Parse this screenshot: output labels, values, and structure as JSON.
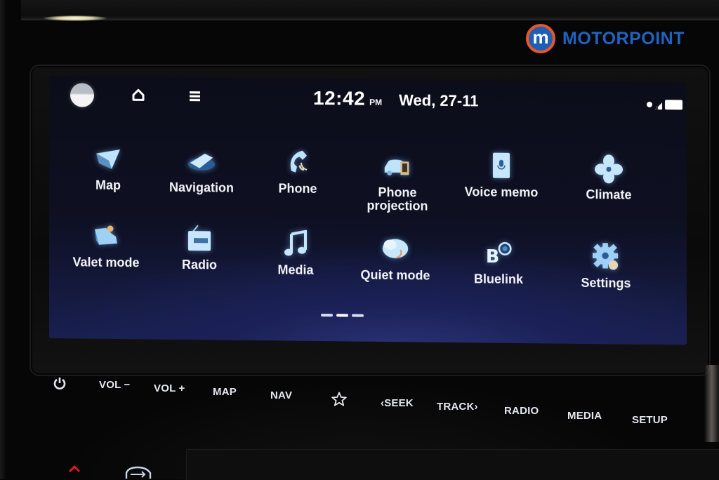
{
  "brand": {
    "logo_letter": "m",
    "name": "MOTORPOINT",
    "colors": {
      "badge": "#1d5fb3",
      "ring": "#e8562a",
      "text": "#1f63c2"
    }
  },
  "status_bar": {
    "time": "12:42",
    "ampm": "PM",
    "date": "Wed, 27-11",
    "icons": [
      "profile-icon",
      "home-icon",
      "menu-icon",
      "signal-icon",
      "battery-icon"
    ]
  },
  "apps": [
    {
      "label": "Map",
      "icon": "map-icon"
    },
    {
      "label": "Navigation",
      "icon": "navigation-icon"
    },
    {
      "label": "Phone",
      "icon": "phone-icon"
    },
    {
      "label": "Phone projection",
      "label_line1": "Phone",
      "label_line2": "projection",
      "icon": "phone-projection-icon"
    },
    {
      "label": "Voice memo",
      "icon": "voice-memo-icon"
    },
    {
      "label": "Climate",
      "icon": "climate-fan-icon"
    },
    {
      "label": "Valet mode",
      "icon": "valet-mode-icon"
    },
    {
      "label": "Radio",
      "icon": "radio-icon"
    },
    {
      "label": "Media",
      "icon": "music-note-icon"
    },
    {
      "label": "Quiet mode",
      "icon": "quiet-mode-icon"
    },
    {
      "label": "Bluelink",
      "icon": "bluelink-icon"
    },
    {
      "label": "Settings",
      "icon": "settings-gear-icon"
    }
  ],
  "pagination": {
    "pages": 3,
    "current": 2
  },
  "hard_keys": [
    {
      "label": "",
      "icon": "power-icon"
    },
    {
      "label": "VOL −"
    },
    {
      "label": "VOL +"
    },
    {
      "label": "MAP"
    },
    {
      "label": "NAV"
    },
    {
      "label": "",
      "icon": "star-icon"
    },
    {
      "label": "‹SEEK"
    },
    {
      "label": "TRACK›"
    },
    {
      "label": "RADIO"
    },
    {
      "label": "MEDIA"
    },
    {
      "label": "SETUP"
    }
  ],
  "lower_controls": [
    "hazard-up-icon",
    "car-recirculation-icon"
  ]
}
